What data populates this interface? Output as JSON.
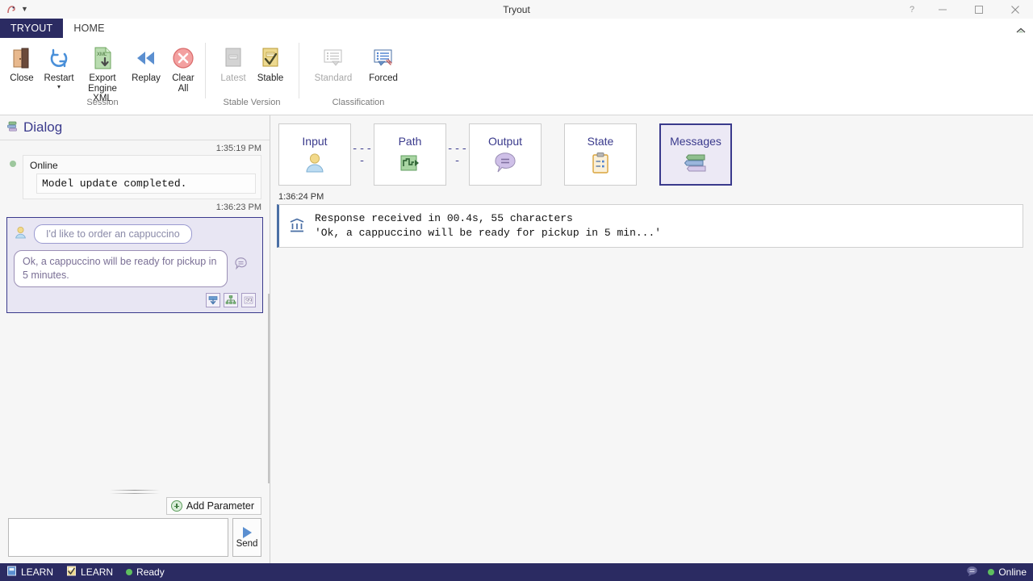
{
  "window": {
    "title": "Tryout",
    "quick_access_icon": "app-icon",
    "quick_access_dropdown": "chevron-down-icon",
    "help_label": "?",
    "minimize_label": "—",
    "maximize_label": "▢",
    "close_label": "✕",
    "ribbon_collapse_icon": "chevron-up-icon"
  },
  "tabs": {
    "file_tab": "TRYOUT",
    "home_tab": "HOME"
  },
  "ribbon": {
    "groups": [
      {
        "label": "Session",
        "items": [
          {
            "name": "close",
            "label": "Close",
            "icon": "open-door-icon",
            "disabled": false,
            "dropdown": false
          },
          {
            "name": "restart",
            "label": "Restart",
            "icon": "refresh-icon",
            "disabled": false,
            "dropdown": true
          },
          {
            "name": "export-engine-xml",
            "label": "Export\nEngine XML",
            "icon": "xml-export-icon",
            "disabled": false,
            "dropdown": false
          },
          {
            "name": "replay",
            "label": "Replay",
            "icon": "rewind-icon",
            "disabled": false,
            "dropdown": false
          },
          {
            "name": "clear-all",
            "label": "Clear\nAll",
            "icon": "clear-circle-icon",
            "disabled": false,
            "dropdown": false
          }
        ]
      },
      {
        "label": "Stable Version",
        "items": [
          {
            "name": "latest",
            "label": "Latest",
            "icon": "document-gray-icon",
            "disabled": true,
            "dropdown": false
          },
          {
            "name": "stable",
            "label": "Stable",
            "icon": "document-check-icon",
            "disabled": false,
            "dropdown": false
          }
        ]
      },
      {
        "label": "Classification",
        "items": [
          {
            "name": "standard",
            "label": "Standard",
            "icon": "list-gray-icon",
            "disabled": true,
            "dropdown": false
          },
          {
            "name": "forced",
            "label": "Forced",
            "icon": "list-forced-icon",
            "disabled": false,
            "dropdown": false
          }
        ]
      }
    ]
  },
  "dialog": {
    "panel_title": "Dialog",
    "panel_icon": "dialog-stack-icon",
    "entries": [
      {
        "timestamp": "1:35:19 PM",
        "kind": "system",
        "status_label": "Online",
        "status_icon": "status-dot-icon",
        "body": "Model update completed."
      },
      {
        "timestamp": "1:36:23 PM",
        "kind": "turn",
        "user_icon": "user-avatar-icon",
        "user_text": "I'd like to order an cappuccino",
        "bot_text": "Ok, a cappuccino will be ready for pickup in 5 minutes.",
        "bot_side_icon": "speech-bubble-icon",
        "actions": [
          {
            "name": "download-action",
            "icon": "download-box-icon"
          },
          {
            "name": "hierarchy-action",
            "icon": "hierarchy-icon"
          },
          {
            "name": "quote-action",
            "icon": "quote-icon"
          }
        ]
      }
    ],
    "add_parameter_label": "Add Parameter",
    "add_parameter_icon": "plus-circle-icon",
    "input_placeholder": "",
    "input_value": "",
    "send_label": "Send",
    "send_icon": "play-triangle-icon"
  },
  "steps": {
    "items": [
      {
        "name": "input",
        "label": "Input",
        "icon": "user-avatar-icon",
        "selected": false,
        "connector_after": "dashes"
      },
      {
        "name": "path",
        "label": "Path",
        "icon": "waveform-icon",
        "selected": false,
        "connector_after": "dashes"
      },
      {
        "name": "output",
        "label": "Output",
        "icon": "speech-bubble-icon",
        "selected": false,
        "connector_after": "gap"
      },
      {
        "name": "state",
        "label": "State",
        "icon": "clipboard-icon",
        "selected": false,
        "connector_after": "gap"
      },
      {
        "name": "messages",
        "label": "Messages",
        "icon": "messages-stack-icon",
        "selected": true,
        "connector_after": "none"
      }
    ],
    "connector_dashes": "----"
  },
  "messages": {
    "timestamp": "1:36:24 PM",
    "rows": [
      {
        "icon": "stats-icon",
        "line1": "Response received in 00.4s, 55 characters",
        "line2": "'Ok, a cappuccino will be ready for pickup in 5 min...'"
      }
    ]
  },
  "statusbar": {
    "left": [
      {
        "name": "learn-model",
        "icon": "learn-blue-icon",
        "label": "LEARN"
      },
      {
        "name": "learn-check",
        "icon": "learn-yellow-icon",
        "label": "LEARN"
      },
      {
        "name": "ready-status",
        "icon": "status-dot-icon",
        "label": "Ready"
      }
    ],
    "right": [
      {
        "name": "chat-status-icon",
        "icon": "speech-bubble-icon",
        "label": ""
      },
      {
        "name": "online-status",
        "icon": "status-dot-icon",
        "label": "Online"
      }
    ]
  },
  "colors": {
    "brand_navy": "#2b2b62",
    "accent_purple": "#3a3a8c",
    "status_green": "#5fbf5f",
    "panel_bg": "#f6f6f6",
    "selected_step_bg": "#ece9f5"
  }
}
